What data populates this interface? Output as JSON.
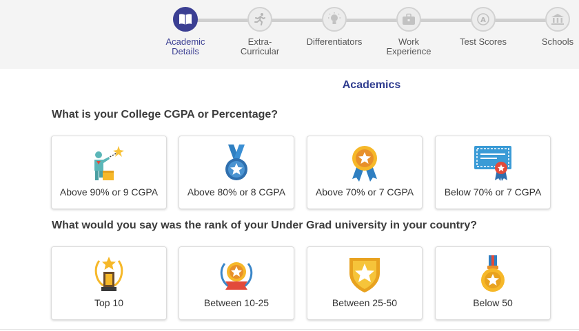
{
  "stepper": {
    "steps": [
      {
        "label_line1": "Academic",
        "label_line2": "Details",
        "icon": "book-icon",
        "active": true
      },
      {
        "label_line1": "Extra-",
        "label_line2": "Curricular",
        "icon": "runner-icon",
        "active": false
      },
      {
        "label_line1": "Differentiators",
        "label_line2": "",
        "icon": "lightbulb-icon",
        "active": false
      },
      {
        "label_line1": "Work",
        "label_line2": "Experience",
        "icon": "briefcase-icon",
        "active": false
      },
      {
        "label_line1": "Test Scores",
        "label_line2": "",
        "icon": "grade-a-icon",
        "active": false
      },
      {
        "label_line1": "Schools",
        "label_line2": "",
        "icon": "institution-icon",
        "active": false
      }
    ]
  },
  "main": {
    "section_title": "Academics",
    "question_1": "What is your College CGPA or Percentage?",
    "cgpa_options": [
      {
        "label": "Above 90% or 9 CGPA",
        "icon": "podium-winner-icon"
      },
      {
        "label": "Above 80% or 8 CGPA",
        "icon": "medal-ribbon-icon"
      },
      {
        "label": "Above 70% or 7 CGPA",
        "icon": "rosette-badge-icon"
      },
      {
        "label": "Below 70% or 7 CGPA",
        "icon": "certificate-icon"
      }
    ],
    "question_2": "What would you say was the rank of your Under Grad university in your country?",
    "rank_options": [
      {
        "label": "Top 10",
        "icon": "trophy-laurel-icon"
      },
      {
        "label": "Between 10-25",
        "icon": "laurel-star-icon"
      },
      {
        "label": "Between 25-50",
        "icon": "shield-star-icon"
      },
      {
        "label": "Below 50",
        "icon": "gold-medal-icon"
      }
    ]
  },
  "colors": {
    "accent": "#3b3f93",
    "title": "#2f3c8f",
    "stepper_bg": "#f4f4f4",
    "gold": "#f6b829",
    "blue_icon": "#3a86c8"
  }
}
